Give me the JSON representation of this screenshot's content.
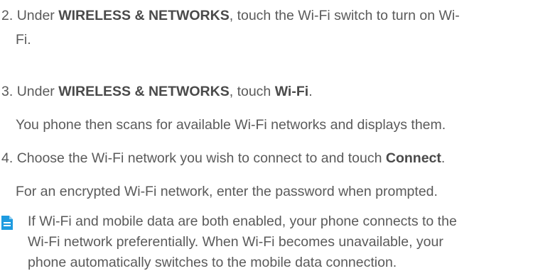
{
  "steps": [
    {
      "num": "2.",
      "pre": "Under ",
      "bold1": "WIRELESS & NETWORKS",
      "post": ", touch the Wi-Fi switch to turn on Wi-",
      "cont": "Fi."
    },
    {
      "num": "3.",
      "pre": "Under ",
      "bold1": "WIRELESS & NETWORKS",
      "mid": ", touch ",
      "bold2": "Wi-Fi",
      "post": ".",
      "note": "You phone then scans for available Wi-Fi networks and displays them."
    },
    {
      "num": "4.",
      "pre": "Choose the Wi-Fi network you wish to connect to and touch ",
      "bold1": "Connect",
      "post": ".",
      "note": "For an encrypted Wi-Fi network, enter the password when prompted."
    }
  ],
  "note_box": {
    "icon": "note-icon",
    "icon_color": "#1e9be0",
    "lines": [
      "If Wi-Fi and mobile data are both enabled, your phone connects to the",
      "Wi-Fi network preferentially. When Wi-Fi becomes unavailable, your",
      "phone automatically switches to the mobile data connection."
    ]
  }
}
